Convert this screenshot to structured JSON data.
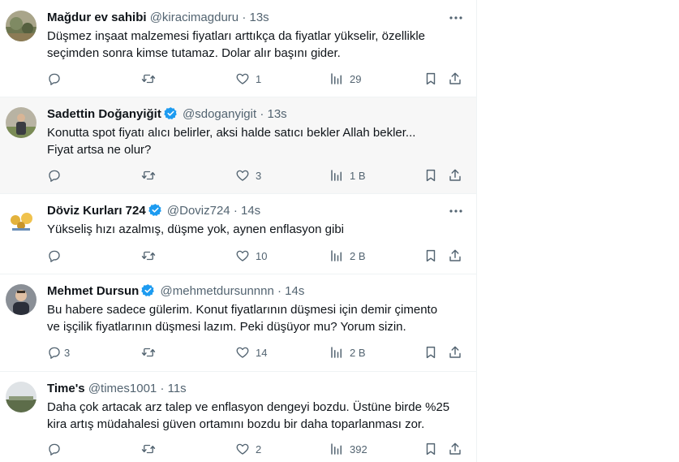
{
  "tweets": [
    {
      "name": "Mağdur ev sahibi",
      "handle": "@kiracimagduru",
      "sep": "·",
      "time": "13s",
      "verified": false,
      "lines": [
        "Düşmez inşaat malzemesi fiyatları arttıkça da fiyatlar yükselir, özellikle",
        "seçimden sonra kimse tutamaz. Dolar alır başını gider."
      ],
      "replies": "",
      "retweets": "",
      "likes": "1",
      "views": "29"
    },
    {
      "name": "Sadettin Doğanyiğit",
      "handle": "@sdoganyigit",
      "sep": "·",
      "time": "13s",
      "verified": true,
      "lines": [
        "Konutta spot fiyatı alıcı belirler, aksi halde satıcı bekler Allah bekler...",
        "Fiyat artsa ne olur?"
      ],
      "replies": "",
      "retweets": "",
      "likes": "3",
      "views": "1 B"
    },
    {
      "name": "Döviz Kurları 724",
      "handle": "@Doviz724",
      "sep": "·",
      "time": "14s",
      "verified": true,
      "lines": [
        "Yükseliş hızı azalmış, düşme yok, aynen enflasyon gibi"
      ],
      "replies": "",
      "retweets": "",
      "likes": "10",
      "views": "2 B"
    },
    {
      "name": "Mehmet Dursun",
      "handle": "@mehmetdursunnnn",
      "sep": "·",
      "time": "14s",
      "verified": true,
      "lines": [
        "Bu habere sadece gülerim. Konut fiyatlarının düşmesi için demir çimento",
        "ve işçilik fiyatlarının düşmesi lazım. Peki düşüyor mu? Yorum sizin."
      ],
      "replies": "3",
      "retweets": "",
      "likes": "14",
      "views": "2 B"
    },
    {
      "name": "Time's",
      "handle": "@times1001",
      "sep": "·",
      "time": "11s",
      "verified": false,
      "lines": [
        "Daha çok artacak arz talep ve enflasyon dengeyi bozdu. Üstüne birde %25",
        "kira artış müdahalesi güven ortamını bozdu bir daha toparlanması zor."
      ],
      "replies": "",
      "retweets": "",
      "likes": "2",
      "views": "392"
    }
  ],
  "icons": {
    "reply": "reply-icon",
    "retweet": "retweet-icon",
    "like": "like-icon",
    "views": "views-icon",
    "bookmark": "bookmark-icon",
    "share": "share-icon",
    "more": "more-icon",
    "verified": "verified-badge-icon"
  },
  "colors": {
    "text": "#0f1419",
    "muted": "#536471",
    "verified": "#1d9bf0",
    "hover_bg": "#f7f7f7",
    "border": "#eff3f4"
  }
}
